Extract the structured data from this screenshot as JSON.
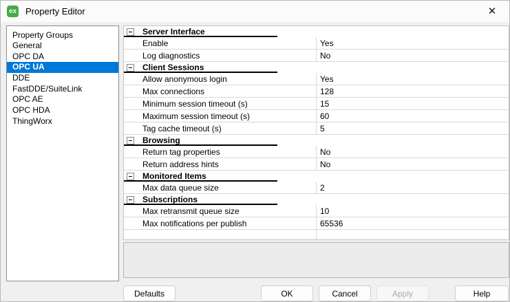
{
  "window": {
    "title": "Property Editor",
    "app_icon": "kepserverex-ex-icon",
    "app_icon_text": "ex",
    "close_glyph": "✕"
  },
  "sidebar": {
    "header": "Property Groups",
    "items": [
      {
        "label": "General",
        "selected": false
      },
      {
        "label": "OPC DA",
        "selected": false
      },
      {
        "label": "OPC UA",
        "selected": true
      },
      {
        "label": "DDE",
        "selected": false
      },
      {
        "label": "FastDDE/SuiteLink",
        "selected": false
      },
      {
        "label": "OPC AE",
        "selected": false
      },
      {
        "label": "OPC HDA",
        "selected": false
      },
      {
        "label": "ThingWorx",
        "selected": false
      }
    ]
  },
  "grid": {
    "sections": [
      {
        "title": "Server Interface",
        "rows": [
          {
            "name": "Enable",
            "value": "Yes"
          },
          {
            "name": "Log diagnostics",
            "value": "No"
          }
        ]
      },
      {
        "title": "Client Sessions",
        "rows": [
          {
            "name": "Allow anonymous login",
            "value": "Yes"
          },
          {
            "name": "Max connections",
            "value": "128"
          },
          {
            "name": "Minimum session timeout (s)",
            "value": "15"
          },
          {
            "name": "Maximum session timeout (s)",
            "value": "60"
          },
          {
            "name": "Tag cache timeout (s)",
            "value": "5"
          }
        ]
      },
      {
        "title": "Browsing",
        "rows": [
          {
            "name": "Return tag properties",
            "value": "No"
          },
          {
            "name": "Return address hints",
            "value": "No"
          }
        ]
      },
      {
        "title": "Monitored Items",
        "rows": [
          {
            "name": "Max data queue size",
            "value": "2"
          }
        ]
      },
      {
        "title": "Subscriptions",
        "rows": [
          {
            "name": "Max retransmit queue size",
            "value": "10"
          },
          {
            "name": "Max notifications per publish",
            "value": "65536"
          }
        ]
      }
    ]
  },
  "buttons": {
    "defaults": "Defaults",
    "ok": "OK",
    "cancel": "Cancel",
    "apply": "Apply",
    "help": "Help"
  },
  "colors": {
    "selection_blue": "#0078d7",
    "icon_green": "#44ad44",
    "section_underline": "#000000",
    "grid_line": "#d9d9d9"
  }
}
